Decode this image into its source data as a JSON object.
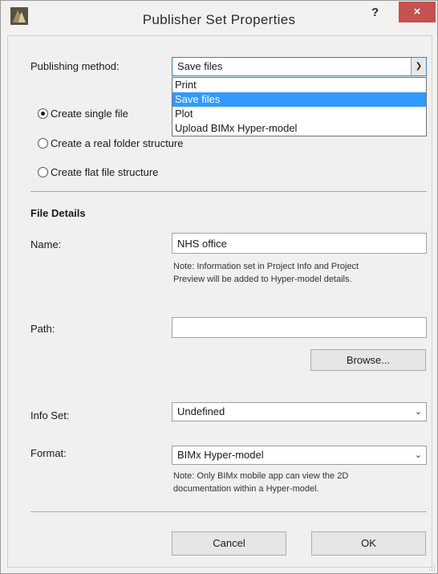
{
  "window": {
    "title": "Publisher Set Properties",
    "help_label": "?",
    "close_label": "×"
  },
  "publishing": {
    "label": "Publishing method:",
    "selected": "Save files",
    "options": [
      "Print",
      "Save files",
      "Plot",
      "Upload BIMx Hyper-model"
    ]
  },
  "structure": {
    "options": [
      {
        "label": "Create single file",
        "checked": true
      },
      {
        "label": "Create a real folder structure",
        "checked": false
      },
      {
        "label": "Create flat file structure",
        "checked": false
      }
    ]
  },
  "file_details": {
    "heading": "File Details",
    "name_label": "Name:",
    "name_value": "NHS office",
    "name_note_line1": "Note: Information set in Project Info and Project",
    "name_note_line2": "Preview will be added to Hyper-model details.",
    "path_label": "Path:",
    "path_value": "",
    "browse_label": "Browse...",
    "info_set_label": "Info Set:",
    "info_set_value": "Undefined",
    "format_label": "Format:",
    "format_value": "BIMx Hyper-model",
    "format_note_line1": "Note: Only BIMx mobile app can view the 2D",
    "format_note_line2": "documentation within a Hyper-model."
  },
  "footer": {
    "cancel_label": "Cancel",
    "ok_label": "OK"
  },
  "colors": {
    "selection": "#3399ff",
    "close_button": "#c75050"
  }
}
